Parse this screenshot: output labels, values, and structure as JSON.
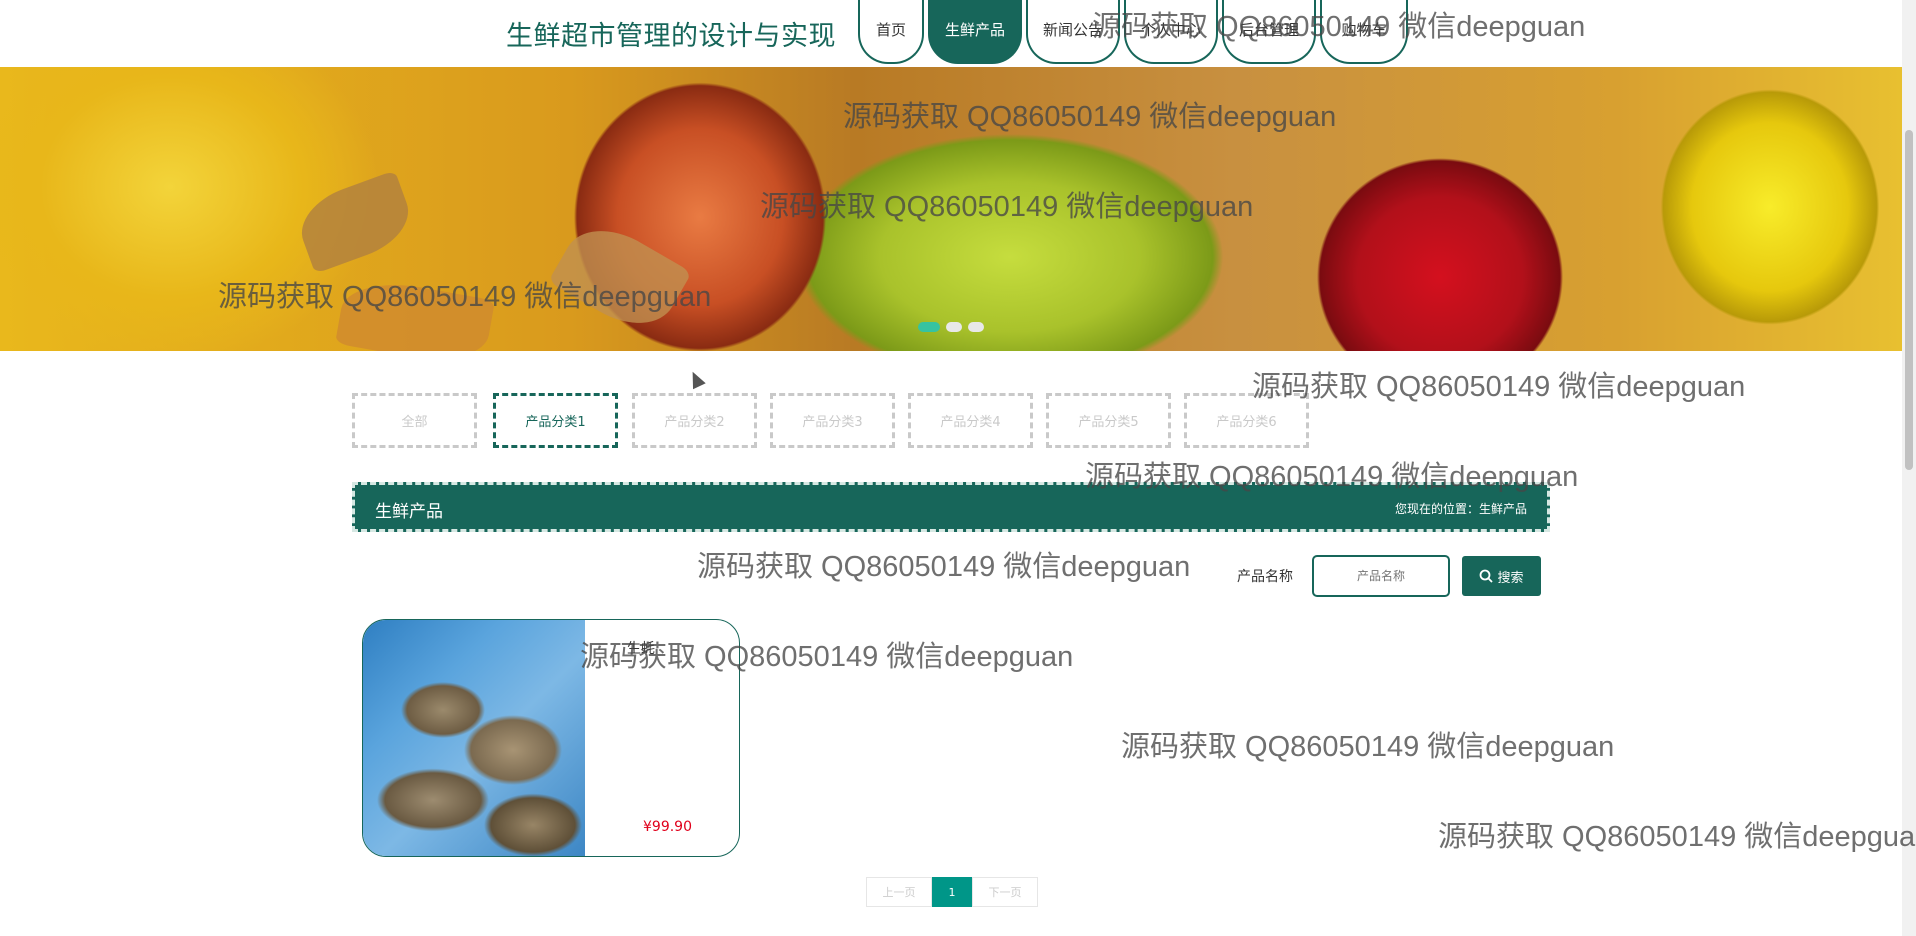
{
  "site": {
    "title": "生鲜超市管理的设计与实现"
  },
  "nav": [
    "首页",
    "生鲜产品",
    "新闻公告",
    "个人中心",
    "后台管理",
    "购物车"
  ],
  "nav_active": "生鲜产品",
  "banner": {
    "slide_count": 3,
    "active_slide": 1
  },
  "categories": [
    "全部",
    "产品分类1",
    "产品分类2",
    "产品分类3",
    "产品分类4",
    "产品分类5",
    "产品分类6"
  ],
  "category_active": "产品分类1",
  "section": {
    "title": "生鲜产品",
    "breadcrumb": "您现在的位置：生鲜产品"
  },
  "search": {
    "label": "产品名称",
    "placeholder": "产品名称",
    "button": "搜索"
  },
  "products": [
    {
      "name": "生蚝",
      "price": "¥99.90"
    }
  ],
  "pagination": {
    "prev": "上一页",
    "current": "1",
    "next": "下一页"
  },
  "watermark": "源码获取 QQ86050149 微信deepguan",
  "colors": {
    "primary": "#17665a",
    "price": "#e0001b",
    "pager_active": "#009688"
  }
}
